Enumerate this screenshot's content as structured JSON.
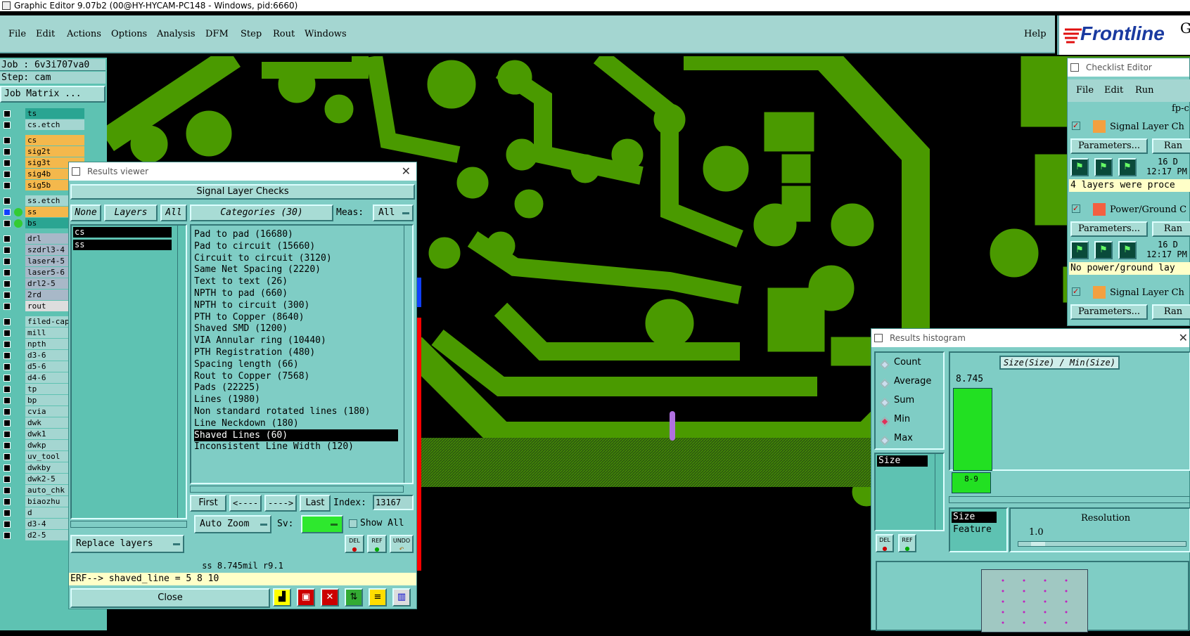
{
  "app": {
    "title": "Graphic Editor 9.07b2 (00@HY-HYCAM-PC148 - Windows, pid:6660)"
  },
  "menu": {
    "items": [
      "File",
      "Edit",
      "Actions",
      "Options",
      "Analysis",
      "DFM",
      "Step",
      "Rout",
      "Windows"
    ],
    "help": "Help",
    "logo": "Frontline",
    "logo_tail": "G"
  },
  "job": {
    "job_line": "Job : 6v3i707va0",
    "step_line": "Step: cam",
    "matrix_button": "Job Matrix ..."
  },
  "layers": [
    {
      "name": "ts",
      "color": "#2aa592"
    },
    {
      "name": "cs.etch",
      "color": "#a4d6d1"
    },
    {
      "name": "cs",
      "color": "#f4b84c"
    },
    {
      "name": "sig2t",
      "color": "#f4b84c"
    },
    {
      "name": "sig3t",
      "color": "#f4b84c"
    },
    {
      "name": "sig4b",
      "color": "#f4b84c"
    },
    {
      "name": "sig5b",
      "color": "#f4b84c"
    },
    {
      "name": "ss.etch",
      "color": "#a4d6d1"
    },
    {
      "name": "ss",
      "color": "#f4b84c"
    },
    {
      "name": "bs",
      "color": "#2aa592"
    },
    {
      "name": "drl",
      "color": "#a8b8c8"
    },
    {
      "name": "szdrl3-4",
      "color": "#a8b8c8"
    },
    {
      "name": "laser4-5",
      "color": "#a8b8c8"
    },
    {
      "name": "laser5-6",
      "color": "#a8b8c8"
    },
    {
      "name": "drl2-5",
      "color": "#a8b8c8"
    },
    {
      "name": "2rd",
      "color": "#a8b8c8"
    },
    {
      "name": "rout",
      "color": "#dddddd"
    },
    {
      "name": "filed-cap",
      "color": "#a4d6d1"
    },
    {
      "name": "mill",
      "color": "#a4d6d1"
    },
    {
      "name": "npth",
      "color": "#a4d6d1"
    },
    {
      "name": "d3-6",
      "color": "#a4d6d1"
    },
    {
      "name": "d5-6",
      "color": "#a4d6d1"
    },
    {
      "name": "d4-6",
      "color": "#a4d6d1"
    },
    {
      "name": "tp",
      "color": "#a4d6d1"
    },
    {
      "name": "bp",
      "color": "#a4d6d1"
    },
    {
      "name": "cvia",
      "color": "#a4d6d1"
    },
    {
      "name": "dwk",
      "color": "#a4d6d1"
    },
    {
      "name": "dwk1",
      "color": "#a4d6d1"
    },
    {
      "name": "dwkp",
      "color": "#a4d6d1"
    },
    {
      "name": "uv_tool",
      "color": "#a4d6d1"
    },
    {
      "name": "dwkby",
      "color": "#a4d6d1"
    },
    {
      "name": "dwk2-5",
      "color": "#a4d6d1"
    },
    {
      "name": "auto_chk",
      "color": "#a4d6d1"
    },
    {
      "name": "biaozhu",
      "color": "#a4d6d1"
    },
    {
      "name": "d",
      "color": "#a4d6d1"
    },
    {
      "name": "d3-4",
      "color": "#a4d6d1"
    },
    {
      "name": "d2-5",
      "color": "#a4d6d1"
    }
  ],
  "results_viewer": {
    "title": "Results viewer",
    "header": "Signal Layer Checks",
    "none_btn": "None",
    "layers_btn": "Layers",
    "all_btn": "All",
    "categories_btn": "Categories (30)",
    "meas_label": "Meas:",
    "meas_value": "All",
    "layers": [
      "cs",
      "ss"
    ],
    "categories": [
      "Pad to pad (16680)",
      "Pad to circuit (15660)",
      "Circuit to circuit (3120)",
      "Same Net Spacing (2220)",
      "Text to text (26)",
      "NPTH to pad (660)",
      "NPTH to circuit (300)",
      "PTH to Copper (8640)",
      "Shaved SMD (1200)",
      "VIA Annular ring (10440)",
      "PTH Registration (480)",
      "Spacing length (66)",
      "Rout to Copper (7568)",
      "Pads (22225)",
      "Lines (1980)",
      "Non standard rotated lines (180)",
      "Line Neckdown (180)",
      "Shaved Lines (60)",
      "Inconsistent Line Width (120)"
    ],
    "selected_index": 17,
    "nav": {
      "first": "First",
      "prev": "<----",
      "next": "---->",
      "last": "Last",
      "index_label": "Index:",
      "index_value": "13167"
    },
    "auto_zoom": "Auto Zoom",
    "sv_label": "Sv:",
    "show_all": "Show All",
    "replace_layers": "Replace layers",
    "del": "DEL",
    "ref": "REF",
    "undo": "UNDO",
    "status": "ss 8.745mil  r9.1",
    "erf": "ERF--> shaved_line = 5 8 10",
    "close": "Close"
  },
  "checklist": {
    "title": "Checklist Editor",
    "menu": [
      "File",
      "Edit",
      "Run"
    ],
    "name": "fp-c",
    "items": [
      {
        "label": "Signal Layer Ch",
        "params": "Parameters...",
        "ran": "Ran",
        "date": "16 D",
        "time": "12:17 PM",
        "msg": "4 layers were proce"
      },
      {
        "label": "Power/Ground C",
        "params": "Parameters...",
        "ran": "Ran",
        "date": "16 D",
        "time": "12:17 PM",
        "msg": "No power/ground lay"
      },
      {
        "label": "Signal Layer Ch",
        "params": "Parameters...",
        "ran": "Ran"
      }
    ]
  },
  "histogram": {
    "title": "Results histogram",
    "modes": [
      "Count",
      "Average",
      "Sum",
      "Min",
      "Max"
    ],
    "selected_mode": "Min",
    "list_item": "Size",
    "chart_title": "Size(Size) / Min(Size)",
    "bar_value": "8.745",
    "bar_label": "8-9",
    "fields": [
      "Size",
      "Feature"
    ],
    "resolution_label": "Resolution",
    "resolution_value": "1.0",
    "del": "DEL",
    "ref": "REF"
  },
  "colors": {
    "copper": "#4a9a00",
    "panel": "#7fcdc5",
    "selection": "#ff0000",
    "pad_marker": "#b070e0"
  }
}
